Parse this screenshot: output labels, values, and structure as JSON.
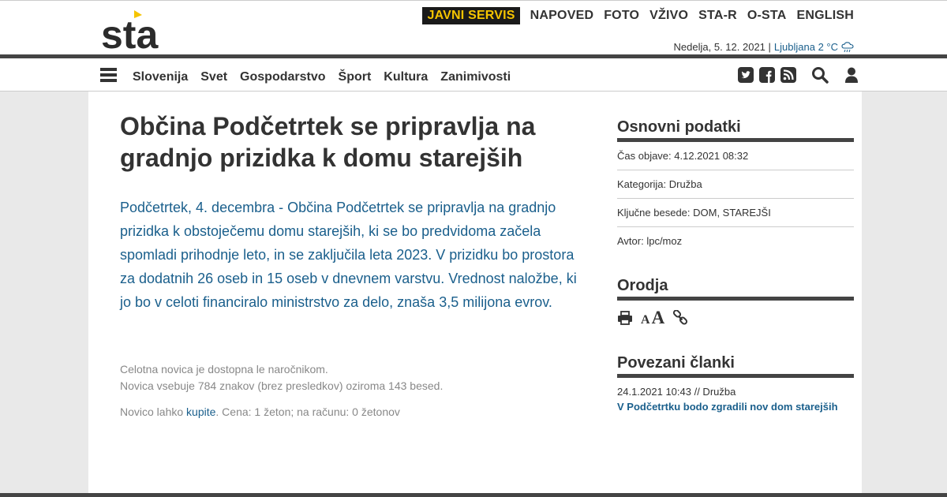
{
  "header": {
    "logo_text": "sta",
    "top_nav": [
      {
        "label": "JAVNI SERVIS",
        "highlight": true
      },
      {
        "label": "NAPOVED"
      },
      {
        "label": "FOTO"
      },
      {
        "label": "VŽIVO"
      },
      {
        "label": "STA-R"
      },
      {
        "label": "O-STA"
      },
      {
        "label": "ENGLISH"
      }
    ],
    "date": "Nedelja, 5. 12. 2021 |",
    "weather": "Ljubljana 2 °C",
    "weather_icon": "rain-cloud-icon"
  },
  "navbar": {
    "menu_icon": "hamburger-icon",
    "items": [
      "Slovenija",
      "Svet",
      "Gospodarstvo",
      "Šport",
      "Kultura",
      "Zanimivosti"
    ],
    "icons": [
      "twitter-icon",
      "facebook-icon",
      "rss-icon",
      "search-icon",
      "user-icon"
    ]
  },
  "article": {
    "title": "Občina Podčetrtek se pripravlja na gradnjo prizidka k domu starejših",
    "lead": "Podčetrtek, 4. decembra - Občina Podčetrtek se pripravlja na gradnjo prizidka k obstoječemu domu starejših, ki se bo predvidoma začela spomladi prihodnje leto, in se zaključila leta 2023. V prizidku bo prostora za dodatnih 26 oseb in 15 oseb v dnevnem varstvu. Vrednost naložbe, ki jo bo v celoti financiralo ministrstvo za delo, znaša 3,5 milijona evrov.",
    "info_line1": "Celotna novica je dostopna le naročnikom.",
    "info_line2": "Novica vsebuje 784 znakov (brez presledkov) oziroma 143 besed.",
    "buy_prefix": "Novico lahko ",
    "buy_link": "kupite",
    "buy_suffix": ". Cena: 1 žeton; na računu: 0 žetonov"
  },
  "sidebar": {
    "basic_title": "Osnovni podatki",
    "basic_rows": [
      "Čas objave: 4.12.2021 08:32",
      "Kategorija: Družba",
      "Ključne besede: DOM, STAREJŠI",
      "Avtor: lpc/moz"
    ],
    "tools_title": "Orodja",
    "tools_icons": [
      "print-icon",
      "font-smaller-icon",
      "font-larger-icon",
      "link-icon"
    ],
    "tools_font_small": "A",
    "tools_font_large": "A",
    "related_title": "Povezani članki",
    "related_meta": "24.1.2021 10:43 // Družba",
    "related_link": "V Podčetrtku bodo zgradili nov dom starejših"
  },
  "colors": {
    "accent_blue": "#1a5f8c",
    "highlight_yellow": "#f5c400",
    "logo_dark": "#2b2b2b"
  }
}
